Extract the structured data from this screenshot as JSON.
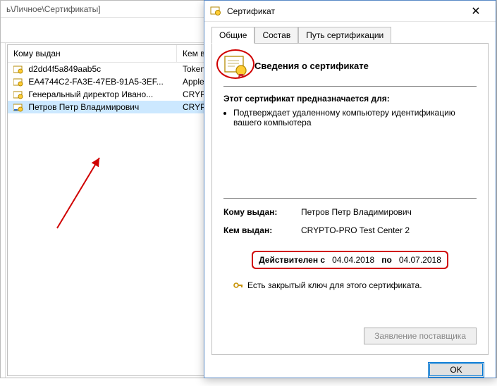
{
  "bg": {
    "pathFragment": "ь\\Личное\\Сертификаты]",
    "columns": {
      "issuedTo": "Кому выдан",
      "issuedBy": "Кем выдан"
    },
    "rows": [
      {
        "to": "d2dd4f5a849aab5c",
        "by": "Token Signin"
      },
      {
        "to": "EA4744C2-FA3E-47EB-91A5-3EF...",
        "by": "Apple iPhone"
      },
      {
        "to": "Генеральный директор Ивано...",
        "by": "CRYPTO-PRO"
      },
      {
        "to": "Петров Петр Владимирович",
        "by": "CRYPTO-PRO"
      }
    ]
  },
  "dlg": {
    "title": "Сертификат",
    "tabs": {
      "general": "Общие",
      "details": "Состав",
      "path": "Путь сертификации"
    },
    "headline": "Сведения о сертификате",
    "purposeTitle": "Этот сертификат предназначается для:",
    "purposes": [
      "Подтверждает удаленному компьютеру идентификацию вашего компьютера"
    ],
    "issuedToLabel": "Кому выдан:",
    "issuedToValue": "Петров Петр Владимирович",
    "issuedByLabel": "Кем выдан:",
    "issuedByValue": "CRYPTO-PRO Test Center 2",
    "validPrefix": "Действителен с",
    "validFrom": "04.04.2018",
    "validMid": "по",
    "validTo": "04.07.2018",
    "keyNote": "Есть закрытый ключ для этого сертификата.",
    "supplierBtn": "Заявление поставщика",
    "ok": "OK"
  }
}
